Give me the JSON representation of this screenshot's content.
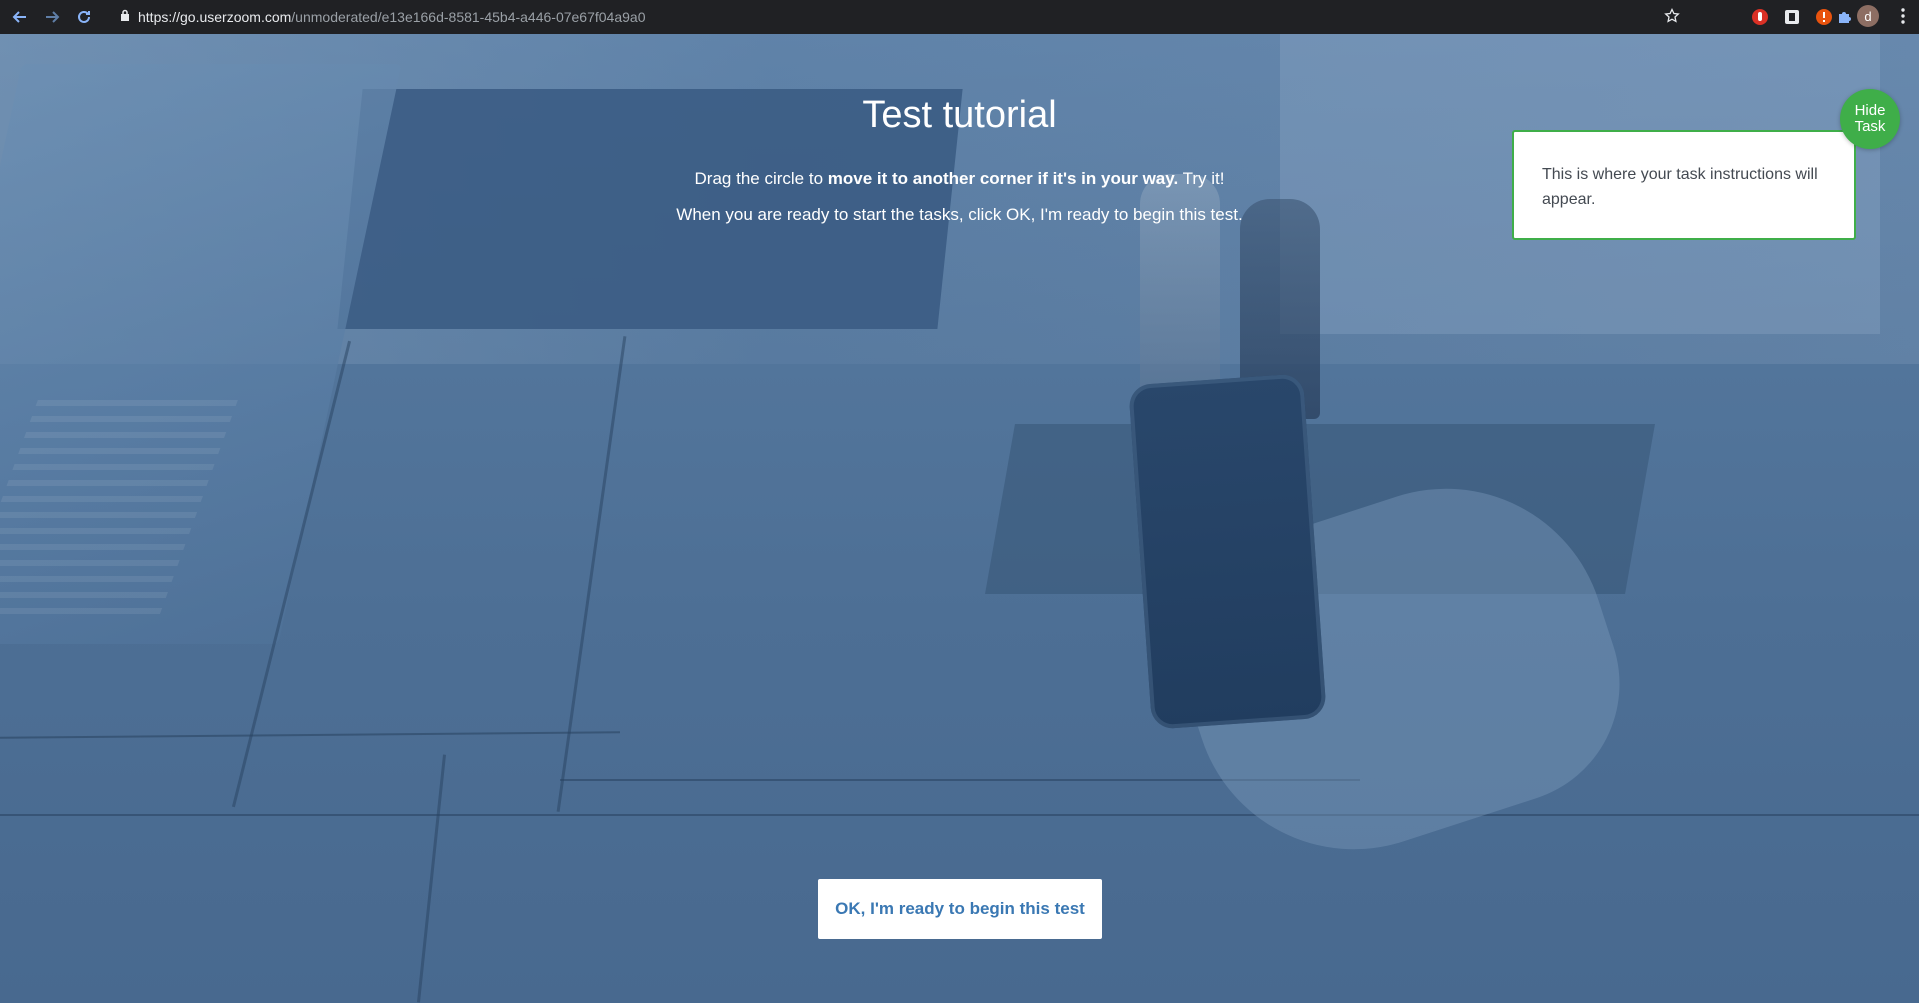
{
  "browser": {
    "url_host": "https://go.userzoom.com",
    "url_path": "/unmoderated/e13e166d-8581-45b4-a446-07e67f04a9a0",
    "profile_initial": "d",
    "icons": [
      "back-arrow-icon",
      "forward-arrow-icon",
      "reload-icon",
      "lock-icon",
      "star-icon",
      "ublock-icon",
      "extension-icon",
      "warning-icon",
      "puzzle-icon",
      "kebab-menu-icon"
    ]
  },
  "page": {
    "title": "Test tutorial",
    "intro_line1_pre": "Drag the circle to ",
    "intro_line1_bold": "move it to another corner if it's in your way.",
    "intro_line1_post": " Try it!",
    "intro_line2": "When you are ready to start the tasks, click OK, I'm ready to begin this test."
  },
  "task_panel": {
    "text": "This is where your task instructions will appear.",
    "hide_line1": "Hide",
    "hide_line2": "Task"
  },
  "actions": {
    "begin_label": "OK, I'm ready to begin this test"
  },
  "colors": {
    "accent_green": "#3fae49",
    "button_text_blue": "#3a78b3",
    "overlay_blue": "#4f729a"
  }
}
